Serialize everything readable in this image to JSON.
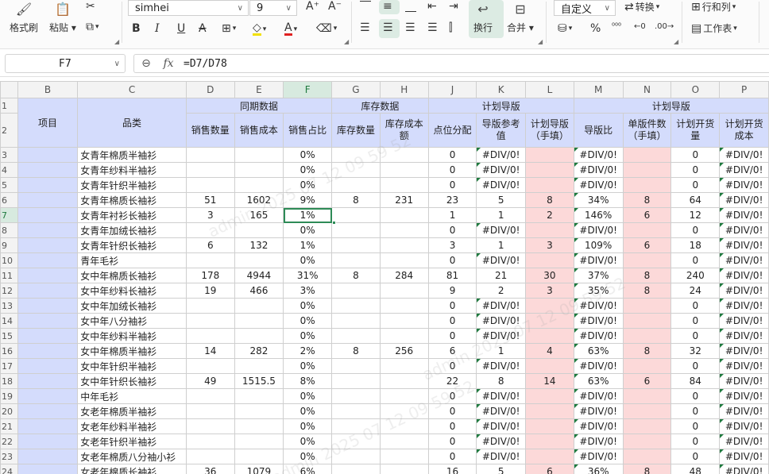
{
  "ribbon": {
    "format_painter": "格式刷",
    "paste": "粘贴",
    "font_name": "simhei",
    "font_size": "9",
    "wrap": "换行",
    "merge": "合并",
    "number_format": "自定义",
    "convert": "转换",
    "rows_cols": "行和列",
    "worksheet": "工作表"
  },
  "formula_bar": {
    "cell_ref": "F7",
    "fx": "fx",
    "formula": "=D7/D78"
  },
  "columns": [
    "B",
    "C",
    "D",
    "E",
    "F",
    "G",
    "H",
    "J",
    "K",
    "L",
    "M",
    "N",
    "O",
    "P"
  ],
  "header": {
    "group_same_period": "同期数据",
    "group_inventory": "库存数据",
    "group_plan_guide": "计划导版",
    "group_plan_guide2": "计划导版",
    "item": "项目",
    "category": "品类",
    "sales_qty": "销售数量",
    "sales_cost": "销售成本",
    "sales_ratio": "销售占比",
    "stock_qty": "库存数量",
    "stock_cost": "库存成本额",
    "slot_alloc": "点位分配",
    "guide_ref": "导版参考值",
    "guide_manual": "计划导版（手填）",
    "guide_ratio": "导版比",
    "unit_qty": "单版件数（手填）",
    "plan_open_qty": "计划开货量",
    "plan_open_cost": "计划开货成本"
  },
  "rows": [
    {
      "n": "3",
      "cat": "女青年棉质半袖衫",
      "d": "",
      "e": "",
      "f": "0%",
      "g": "",
      "h": "",
      "j": "0",
      "k": "#DIV/0!",
      "l": "",
      "m": "#DIV/0!",
      "nn": "",
      "o": "0",
      "p": "#DIV/0!"
    },
    {
      "n": "4",
      "cat": "女青年纱料半袖衫",
      "d": "",
      "e": "",
      "f": "0%",
      "g": "",
      "h": "",
      "j": "0",
      "k": "#DIV/0!",
      "l": "",
      "m": "#DIV/0!",
      "nn": "",
      "o": "0",
      "p": "#DIV/0!"
    },
    {
      "n": "5",
      "cat": "女青年针织半袖衫",
      "d": "",
      "e": "",
      "f": "0%",
      "g": "",
      "h": "",
      "j": "0",
      "k": "#DIV/0!",
      "l": "",
      "m": "#DIV/0!",
      "nn": "",
      "o": "0",
      "p": "#DIV/0!"
    },
    {
      "n": "6",
      "cat": "女青年棉质长袖衫",
      "d": "51",
      "e": "1602",
      "f": "9%",
      "g": "8",
      "h": "231",
      "j": "23",
      "k": "5",
      "l": "8",
      "m": "34%",
      "nn": "8",
      "o": "64",
      "p": "#DIV/0!"
    },
    {
      "n": "7",
      "cat": "女青年衬衫长袖衫",
      "d": "3",
      "e": "165",
      "f": "1%",
      "g": "",
      "h": "",
      "j": "1",
      "k": "1",
      "l": "2",
      "m": "146%",
      "nn": "6",
      "o": "12",
      "p": "#DIV/0!"
    },
    {
      "n": "8",
      "cat": "女青年加绒长袖衫",
      "d": "",
      "e": "",
      "f": "0%",
      "g": "",
      "h": "",
      "j": "0",
      "k": "#DIV/0!",
      "l": "",
      "m": "#DIV/0!",
      "nn": "",
      "o": "0",
      "p": "#DIV/0!"
    },
    {
      "n": "9",
      "cat": "女青年针织长袖衫",
      "d": "6",
      "e": "132",
      "f": "1%",
      "g": "",
      "h": "",
      "j": "3",
      "k": "1",
      "l": "3",
      "m": "109%",
      "nn": "6",
      "o": "18",
      "p": "#DIV/0!"
    },
    {
      "n": "10",
      "cat": "青年毛衫",
      "d": "",
      "e": "",
      "f": "0%",
      "g": "",
      "h": "",
      "j": "0",
      "k": "#DIV/0!",
      "l": "",
      "m": "#DIV/0!",
      "nn": "",
      "o": "0",
      "p": "#DIV/0!"
    },
    {
      "n": "11",
      "cat": "女中年棉质长袖衫",
      "d": "178",
      "e": "4944",
      "f": "31%",
      "g": "8",
      "h": "284",
      "j": "81",
      "k": "21",
      "l": "30",
      "m": "37%",
      "nn": "8",
      "o": "240",
      "p": "#DIV/0!"
    },
    {
      "n": "12",
      "cat": "女中年纱料长袖衫",
      "d": "19",
      "e": "466",
      "f": "3%",
      "g": "",
      "h": "",
      "j": "9",
      "k": "2",
      "l": "3",
      "m": "35%",
      "nn": "8",
      "o": "24",
      "p": "#DIV/0!"
    },
    {
      "n": "13",
      "cat": "女中年加绒长袖衫",
      "d": "",
      "e": "",
      "f": "0%",
      "g": "",
      "h": "",
      "j": "0",
      "k": "#DIV/0!",
      "l": "",
      "m": "#DIV/0!",
      "nn": "",
      "o": "0",
      "p": "#DIV/0!"
    },
    {
      "n": "14",
      "cat": "女中年八分袖衫",
      "d": "",
      "e": "",
      "f": "0%",
      "g": "",
      "h": "",
      "j": "0",
      "k": "#DIV/0!",
      "l": "",
      "m": "#DIV/0!",
      "nn": "",
      "o": "0",
      "p": "#DIV/0!"
    },
    {
      "n": "15",
      "cat": "女中年纱料半袖衫",
      "d": "",
      "e": "",
      "f": "0%",
      "g": "",
      "h": "",
      "j": "0",
      "k": "#DIV/0!",
      "l": "",
      "m": "#DIV/0!",
      "nn": "",
      "o": "0",
      "p": "#DIV/0!"
    },
    {
      "n": "16",
      "cat": "女中年棉质半袖衫",
      "d": "14",
      "e": "282",
      "f": "2%",
      "g": "8",
      "h": "256",
      "j": "6",
      "k": "1",
      "l": "4",
      "m": "63%",
      "nn": "8",
      "o": "32",
      "p": "#DIV/0!"
    },
    {
      "n": "17",
      "cat": "女中年针织半袖衫",
      "d": "",
      "e": "",
      "f": "0%",
      "g": "",
      "h": "",
      "j": "0",
      "k": "#DIV/0!",
      "l": "",
      "m": "#DIV/0!",
      "nn": "",
      "o": "0",
      "p": "#DIV/0!"
    },
    {
      "n": "18",
      "cat": "女中年针织长袖衫",
      "d": "49",
      "e": "1515.5",
      "f": "8%",
      "g": "",
      "h": "",
      "j": "22",
      "k": "8",
      "l": "14",
      "m": "63%",
      "nn": "6",
      "o": "84",
      "p": "#DIV/0!"
    },
    {
      "n": "19",
      "cat": "中年毛衫",
      "d": "",
      "e": "",
      "f": "0%",
      "g": "",
      "h": "",
      "j": "0",
      "k": "#DIV/0!",
      "l": "",
      "m": "#DIV/0!",
      "nn": "",
      "o": "0",
      "p": "#DIV/0!"
    },
    {
      "n": "20",
      "cat": "女老年棉质半袖衫",
      "d": "",
      "e": "",
      "f": "0%",
      "g": "",
      "h": "",
      "j": "0",
      "k": "#DIV/0!",
      "l": "",
      "m": "#DIV/0!",
      "nn": "",
      "o": "0",
      "p": "#DIV/0!"
    },
    {
      "n": "21",
      "cat": "女老年纱料半袖衫",
      "d": "",
      "e": "",
      "f": "0%",
      "g": "",
      "h": "",
      "j": "0",
      "k": "#DIV/0!",
      "l": "",
      "m": "#DIV/0!",
      "nn": "",
      "o": "0",
      "p": "#DIV/0!"
    },
    {
      "n": "22",
      "cat": "女老年针织半袖衫",
      "d": "",
      "e": "",
      "f": "0%",
      "g": "",
      "h": "",
      "j": "0",
      "k": "#DIV/0!",
      "l": "",
      "m": "#DIV/0!",
      "nn": "",
      "o": "0",
      "p": "#DIV/0!"
    },
    {
      "n": "23",
      "cat": "女老年棉质八分袖小衫",
      "d": "",
      "e": "",
      "f": "0%",
      "g": "",
      "h": "",
      "j": "0",
      "k": "#DIV/0!",
      "l": "",
      "m": "#DIV/0!",
      "nn": "",
      "o": "0",
      "p": "#DIV/0!"
    },
    {
      "n": "24",
      "cat": "女老年棉质长袖衫",
      "d": "36",
      "e": "1079",
      "f": "6%",
      "g": "",
      "h": "",
      "j": "16",
      "k": "5",
      "l": "6",
      "m": "36%",
      "nn": "8",
      "o": "48",
      "p": "#DIV/0!"
    }
  ],
  "colors": {
    "header_blue": "#d4dcfc",
    "manual_pink": "#fcd9d9",
    "selection_green": "#2e8b57"
  }
}
